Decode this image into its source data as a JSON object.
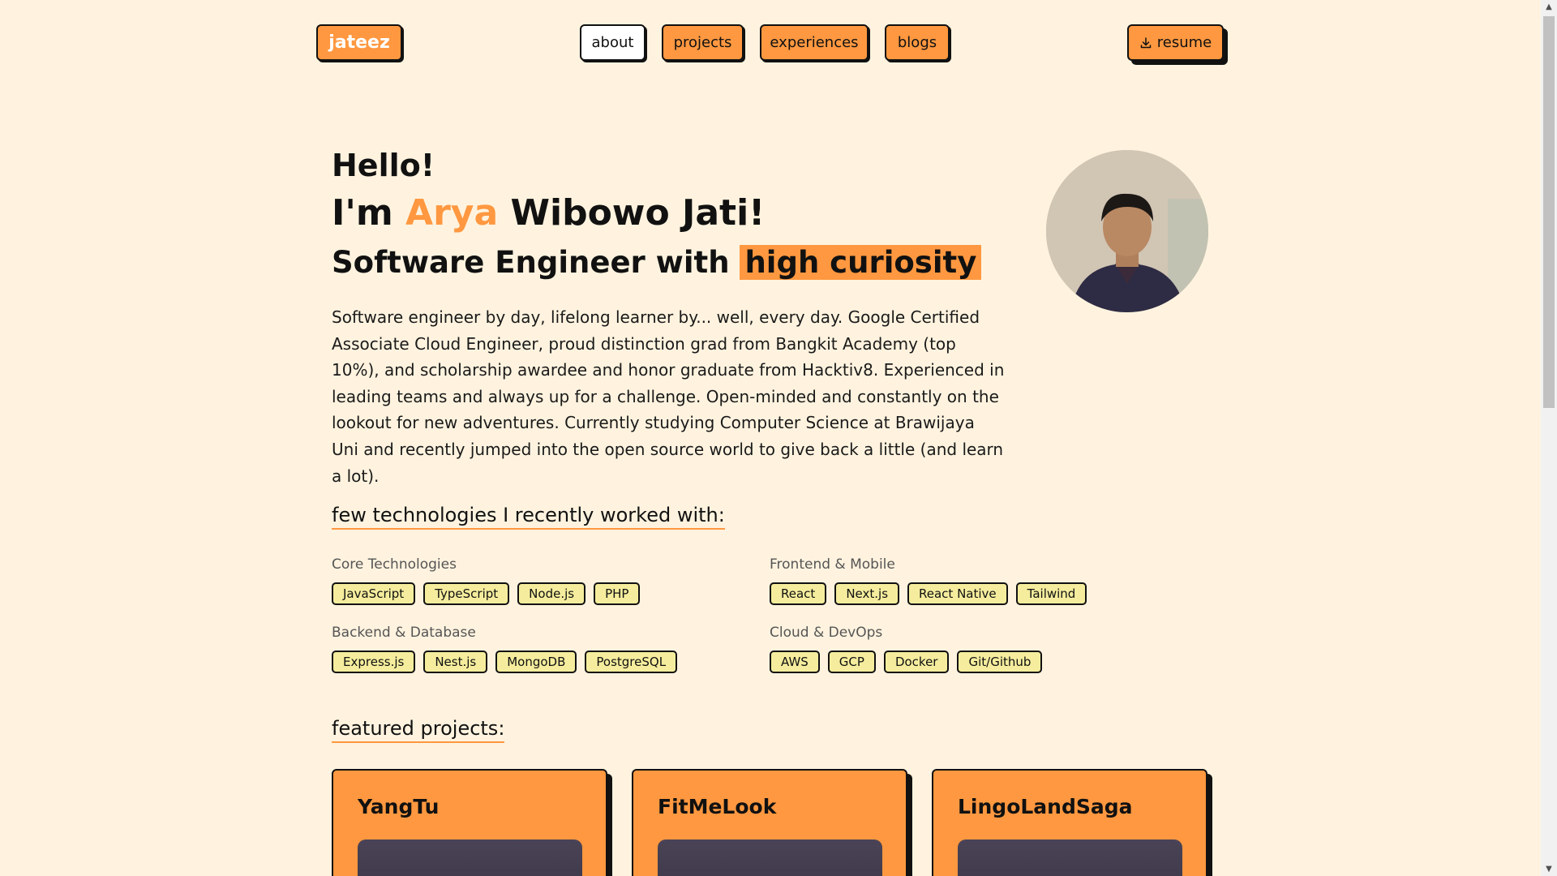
{
  "nav": {
    "logo": "jateez",
    "links": [
      "about",
      "projects",
      "experiences",
      "blogs"
    ],
    "resume_label": "resume",
    "resume_icon": "download-icon"
  },
  "hero": {
    "greeting": "Hello!",
    "name_prefix": "I'm ",
    "name_first": "Arya",
    "name_rest": " Wibowo Jati!",
    "tagline_prefix": "Software Engineer with ",
    "tagline_highlight": "high curiosity",
    "bio": "Software engineer by day, lifelong learner by... well, every day. Google Certified Associate Cloud Engineer, proud distinction grad from Bangkit Academy (top 10%), and scholarship awardee and honor graduate from Hacktiv8. Experienced in leading teams and always up for a challenge. Open-minded and constantly on the lookout for new adventures. Currently studying Computer Science at Brawijaya Uni and recently jumped into the open source world to give back a little (and learn a lot)."
  },
  "technologies": {
    "heading": "few technologies I recently worked with:",
    "groups": [
      {
        "label": "Core Technologies",
        "items": [
          "JavaScript",
          "TypeScript",
          "Node.js",
          "PHP"
        ]
      },
      {
        "label": "Frontend & Mobile",
        "items": [
          "React",
          "Next.js",
          "React Native",
          "Tailwind"
        ]
      },
      {
        "label": "Backend & Database",
        "items": [
          "Express.js",
          "Nest.js",
          "MongoDB",
          "PostgreSQL"
        ]
      },
      {
        "label": "Cloud & DevOps",
        "items": [
          "AWS",
          "GCP",
          "Docker",
          "Git/Github"
        ]
      }
    ]
  },
  "projects": {
    "heading": "featured projects:",
    "cards": [
      {
        "title": "YangTu"
      },
      {
        "title": "FitMeLook"
      },
      {
        "title": "LingoLandSaga"
      }
    ]
  },
  "colors": {
    "accent": "#ff9840",
    "background": "#fff3df",
    "tag_bg": "#f5ed9d",
    "outline": "#111111"
  }
}
